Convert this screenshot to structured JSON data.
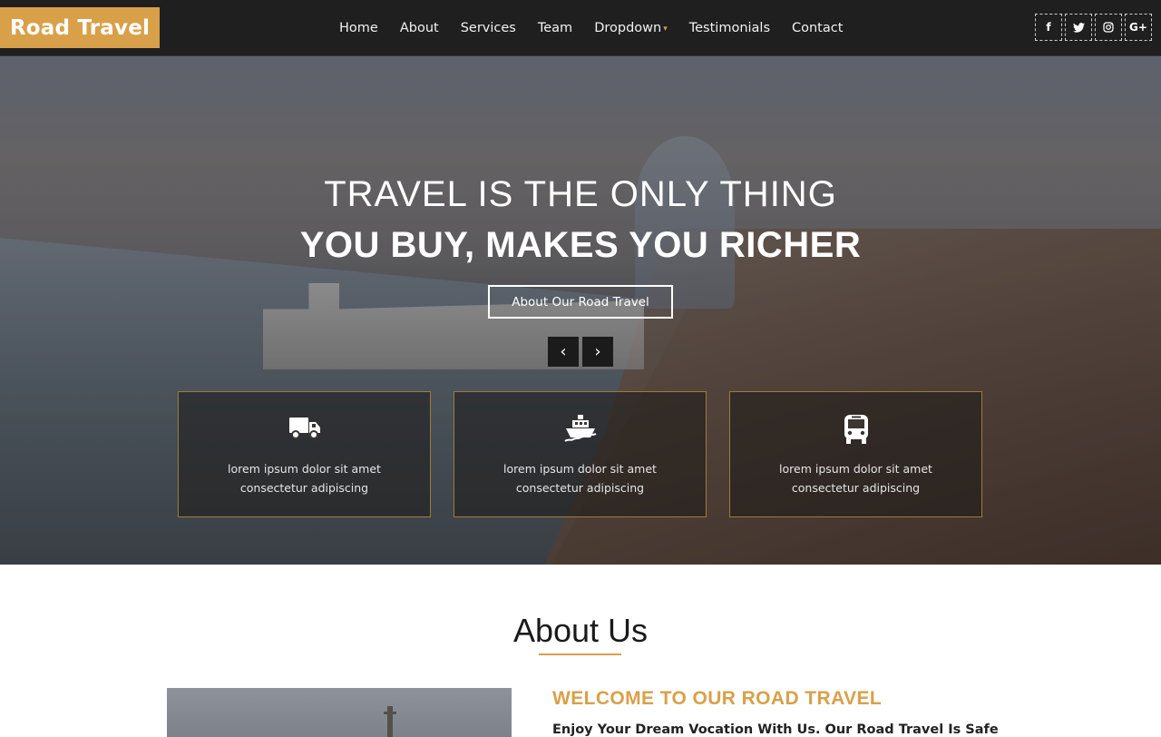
{
  "brand": "Road Travel",
  "nav": {
    "links": [
      "Home",
      "About",
      "Services",
      "Team",
      "Dropdown",
      "Testimonials",
      "Contact"
    ],
    "dropdown_caret": "▾"
  },
  "social": [
    {
      "icon": "facebook-icon",
      "glyph": "f"
    },
    {
      "icon": "twitter-icon",
      "glyph": "🐦"
    },
    {
      "icon": "instagram-icon",
      "glyph": "◎"
    },
    {
      "icon": "google-plus-icon",
      "glyph": "G+"
    }
  ],
  "hero": {
    "line1": "TRAVEL IS THE ONLY THING",
    "line2": "YOU BUY, MAKES YOU RICHER",
    "cta": "About Our Road Travel",
    "prev": "‹",
    "next": "›"
  },
  "features": [
    {
      "icon": "truck-icon",
      "line1": "lorem ipsum dolor sit amet",
      "line2": "consectetur adipiscing"
    },
    {
      "icon": "ship-icon",
      "line1": "lorem ipsum dolor sit amet",
      "line2": "consectetur adipiscing"
    },
    {
      "icon": "bus-icon",
      "line1": "lorem ipsum dolor sit amet",
      "line2": "consectetur adipiscing"
    }
  ],
  "about": {
    "title": "About Us",
    "welcome_title": "WELCOME TO OUR ROAD TRAVEL",
    "welcome_text": "Enjoy Your Dream Vocation With Us. Our Road Travel Is Safe"
  },
  "colors": {
    "accent": "#d9a04a",
    "nav_bg": "#1f1f1f"
  }
}
